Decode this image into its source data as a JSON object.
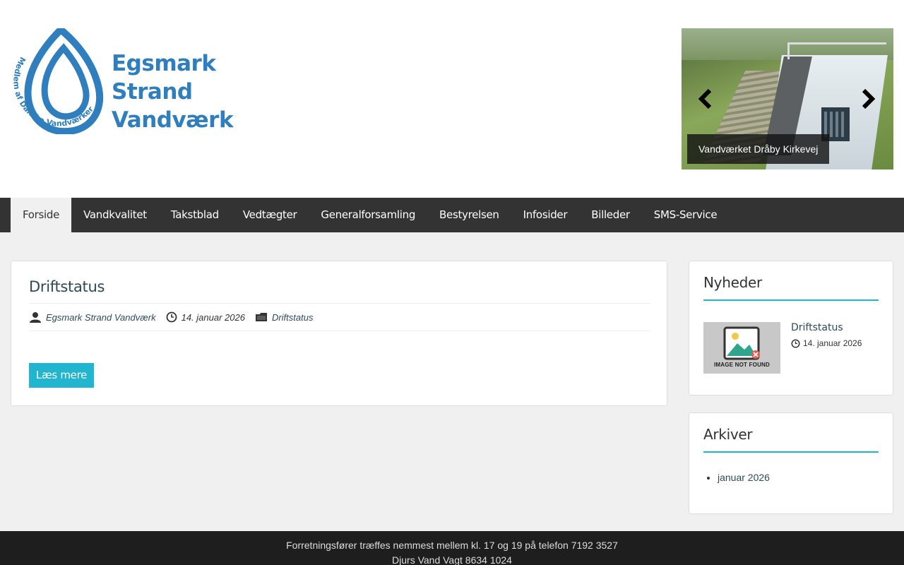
{
  "site": {
    "name_line1": "Egsmark Strand",
    "name_line2": "Vandværk",
    "logo_ring_text": "Medlem af Danske Vandværker"
  },
  "slider": {
    "caption": "Vandværket Dråby Kirkevej",
    "prev_icon": "chevron-left-icon",
    "next_icon": "chevron-right-icon"
  },
  "nav": {
    "items": [
      {
        "label": "Forside",
        "active": true
      },
      {
        "label": "Vandkvalitet"
      },
      {
        "label": "Takstblad"
      },
      {
        "label": "Vedtægter"
      },
      {
        "label": "Generalforsamling"
      },
      {
        "label": "Bestyrelsen"
      },
      {
        "label": "Infosider"
      },
      {
        "label": "Billeder"
      },
      {
        "label": "SMS-Service"
      }
    ]
  },
  "post": {
    "title": "Driftstatus",
    "author": "Egsmark Strand Vandværk",
    "date": "14. januar 2026",
    "category": "Driftstatus",
    "read_more": "Læs mere"
  },
  "news_widget": {
    "title": "Nyheder",
    "thumb_text": "IMAGE NOT FOUND",
    "item_title": "Driftstatus",
    "item_date": "14. januar 2026"
  },
  "archive_widget": {
    "title": "Arkiver",
    "items": [
      "januar 2026"
    ]
  },
  "footer": {
    "line1": "Forretningsfører træffes nemmest mellem kl. 17 og 19 på telefon 7192 3527",
    "line2": "Djurs Vand Vagt 8634 1024"
  },
  "colors": {
    "accent": "#22b5cf",
    "logo_blue": "#2f7fbf",
    "nav_bg": "#333333",
    "footer_bg": "#1e1e1e"
  }
}
